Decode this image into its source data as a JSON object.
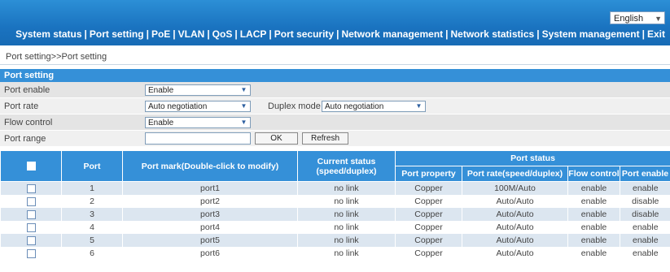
{
  "header": {
    "language": "English",
    "nav": [
      "System status",
      "Port setting",
      "PoE",
      "VLAN",
      "QoS",
      "LACP",
      "Port security",
      "Network management",
      "Network statistics",
      "System management",
      "Exit"
    ]
  },
  "breadcrumb": "Port setting>>Port setting",
  "section_title": "Port setting",
  "form": {
    "port_enable": {
      "label": "Port enable",
      "value": "Enable"
    },
    "port_rate": {
      "label": "Port rate",
      "value": "Auto negotiation"
    },
    "duplex_mode": {
      "label": "Duplex mode",
      "value": "Auto negotiation"
    },
    "flow_control": {
      "label": "Flow control",
      "value": "Enable"
    },
    "port_range": {
      "label": "Port range",
      "value": ""
    },
    "ok_label": "OK",
    "refresh_label": "Refresh"
  },
  "table": {
    "headers": {
      "port": "Port",
      "mark": "Port mark(Double-click to modify)",
      "current_status_1": "Current status",
      "current_status_2": "(speed/duplex)",
      "port_status": "Port status",
      "property": "Port property",
      "rate": "Port rate(speed/duplex)",
      "flow": "Flow control",
      "enable": "Port enable"
    },
    "rows": [
      {
        "port": "1",
        "mark": "port1",
        "status": "no link",
        "property": "Copper",
        "rate": "100M/Auto",
        "flow": "enable",
        "enable": "enable"
      },
      {
        "port": "2",
        "mark": "port2",
        "status": "no link",
        "property": "Copper",
        "rate": "Auto/Auto",
        "flow": "enable",
        "enable": "disable"
      },
      {
        "port": "3",
        "mark": "port3",
        "status": "no link",
        "property": "Copper",
        "rate": "Auto/Auto",
        "flow": "enable",
        "enable": "disable"
      },
      {
        "port": "4",
        "mark": "port4",
        "status": "no link",
        "property": "Copper",
        "rate": "Auto/Auto",
        "flow": "enable",
        "enable": "enable"
      },
      {
        "port": "5",
        "mark": "port5",
        "status": "no link",
        "property": "Copper",
        "rate": "Auto/Auto",
        "flow": "enable",
        "enable": "enable"
      },
      {
        "port": "6",
        "mark": "port6",
        "status": "no link",
        "property": "Copper",
        "rate": "Auto/Auto",
        "flow": "enable",
        "enable": "enable"
      }
    ]
  },
  "colors": {
    "header_blue": "#1a73c0",
    "table_header": "#3590d8",
    "row_shade": "#dce6f0",
    "form_bg": "#e4e4e4"
  }
}
